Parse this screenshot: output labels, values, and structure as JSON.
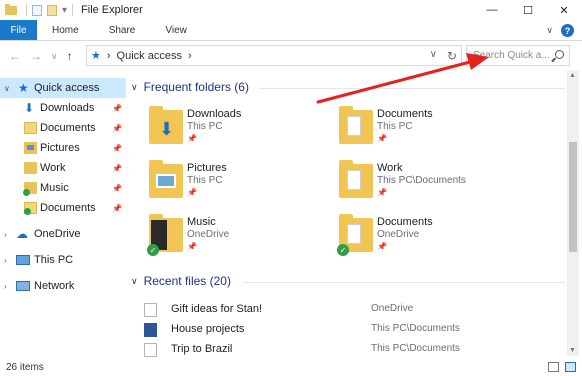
{
  "window": {
    "title": "File Explorer",
    "minimize": "—",
    "maximize": "☐",
    "close": "✕"
  },
  "ribbon": {
    "tabs": [
      "File",
      "Home",
      "Share",
      "View"
    ],
    "expand": "∨",
    "help": "?"
  },
  "address": {
    "back": "←",
    "forward": "→",
    "recent": "∨",
    "up": "↑",
    "path": "Quick access",
    "path_sep": "›",
    "dropdown": "∨",
    "refresh": "↻",
    "search_placeholder": "Search Quick a..."
  },
  "nav_pane": {
    "items": [
      {
        "label": "Quick access",
        "icon": "star-icon"
      },
      {
        "label": "Downloads",
        "icon": "download-icon"
      },
      {
        "label": "Documents",
        "icon": "documents-folder-icon"
      },
      {
        "label": "Pictures",
        "icon": "pictures-folder-icon"
      },
      {
        "label": "Work",
        "icon": "folder-icon"
      },
      {
        "label": "Music",
        "icon": "music-folder-icon"
      },
      {
        "label": "Documents",
        "icon": "documents-folder-icon"
      },
      {
        "label": "OneDrive",
        "icon": "cloud-icon"
      },
      {
        "label": "This PC",
        "icon": "computer-icon"
      },
      {
        "label": "Network",
        "icon": "network-icon"
      }
    ]
  },
  "frequent": {
    "header": "Frequent folders (6)",
    "folders": [
      {
        "name": "Downloads",
        "location": "This PC"
      },
      {
        "name": "Documents",
        "location": "This PC"
      },
      {
        "name": "Pictures",
        "location": "This PC"
      },
      {
        "name": "Work",
        "location": "This PC\\Documents"
      },
      {
        "name": "Music",
        "location": "OneDrive"
      },
      {
        "name": "Documents",
        "location": "OneDrive"
      }
    ]
  },
  "recent": {
    "header": "Recent files (20)",
    "files": [
      {
        "name": "Gift ideas for Stan!",
        "location": "OneDrive"
      },
      {
        "name": "House projects",
        "location": "This PC\\Documents"
      },
      {
        "name": "Trip to Brazil",
        "location": "This PC\\Documents"
      }
    ]
  },
  "status": {
    "item_count": "26 items"
  },
  "colors": {
    "accent": "#1979ca",
    "selection": "#cce8ff",
    "folder": "#f0c553",
    "annotation_arrow": "#e8201b"
  }
}
